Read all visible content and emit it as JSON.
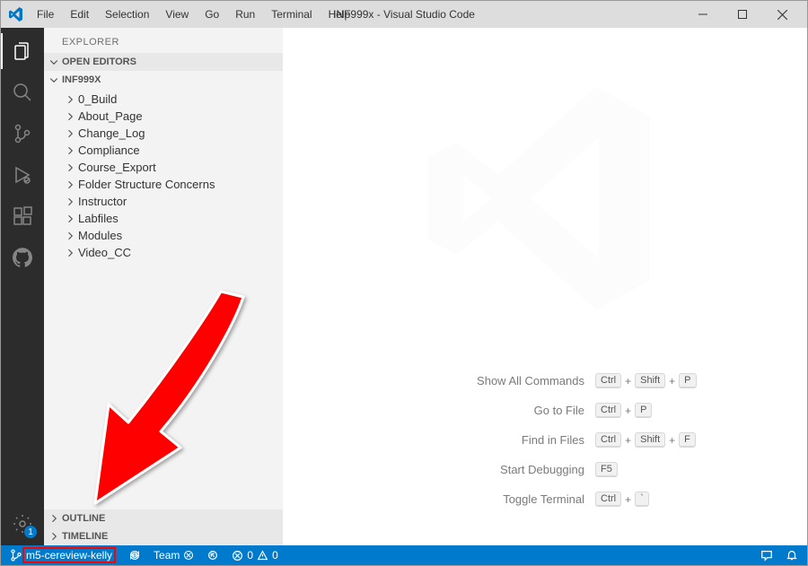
{
  "window": {
    "title": "INF999x - Visual Studio Code"
  },
  "menu": {
    "items": [
      "File",
      "Edit",
      "Selection",
      "View",
      "Go",
      "Run",
      "Terminal",
      "Help"
    ]
  },
  "activity": {
    "settings_badge": "1"
  },
  "explorer": {
    "title": "EXPLORER",
    "open_editors_label": "OPEN EDITORS",
    "project_label": "INF999X",
    "folders": [
      "0_Build",
      "About_Page",
      "Change_Log",
      "Compliance",
      "Course_Export",
      "Folder Structure Concerns",
      "Instructor",
      "Labfiles",
      "Modules",
      "Video_CC"
    ],
    "outline_label": "OUTLINE",
    "timeline_label": "TIMELINE"
  },
  "shortcuts": {
    "show_all": {
      "label": "Show All Commands",
      "k1": "Ctrl",
      "k2": "Shift",
      "k3": "P"
    },
    "go_file": {
      "label": "Go to File",
      "k1": "Ctrl",
      "k2": "P"
    },
    "find": {
      "label": "Find in Files",
      "k1": "Ctrl",
      "k2": "Shift",
      "k3": "F"
    },
    "debug": {
      "label": "Start Debugging",
      "k1": "F5"
    },
    "terminal": {
      "label": "Toggle Terminal",
      "k1": "Ctrl",
      "k2": "`"
    }
  },
  "status": {
    "branch": "m5-cereview-kelly",
    "team_label": "Team",
    "errors": "0",
    "warnings": "0"
  }
}
